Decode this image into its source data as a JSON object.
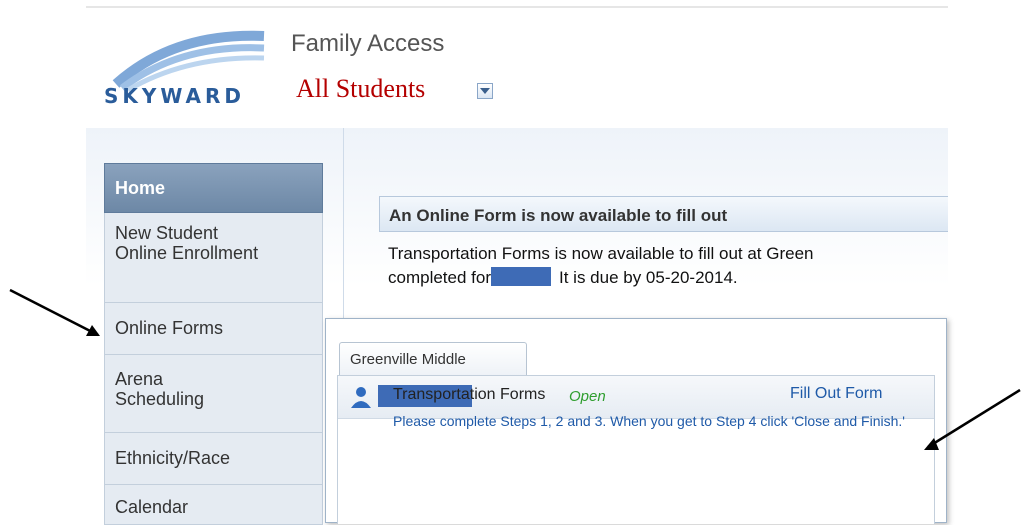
{
  "header": {
    "logo_text": "SKYWARD",
    "app_title": "Family Access",
    "student_selector": "All Students"
  },
  "sidebar": {
    "items": [
      {
        "label": "Home",
        "active": true
      },
      {
        "label": "New Student Online Enrollment"
      },
      {
        "label": "Online Forms"
      },
      {
        "label": "Arena Scheduling"
      },
      {
        "label": "Ethnicity/Race"
      },
      {
        "label": "Calendar"
      }
    ]
  },
  "notice": {
    "title": "An Online Form is now available to fill out",
    "line1": "Transportation Forms is now available to fill out at Green",
    "line2_prefix": "completed for",
    "line2_suffix": "It is due by 05-20-2014."
  },
  "popup": {
    "tab_label": "Greenville Middle",
    "form_name": "Transportation Forms",
    "form_status": "Open",
    "fill_link": "Fill Out Form",
    "instructions": "Please complete Steps 1, 2 and 3. When you get to Step 4 click 'Close and Finish.'"
  },
  "colors": {
    "brand": "#2a5c9a",
    "student_selector": "#b40000",
    "link": "#1f5aa8",
    "status_open": "#2f9e2f",
    "redaction": "#3e6bb6"
  }
}
